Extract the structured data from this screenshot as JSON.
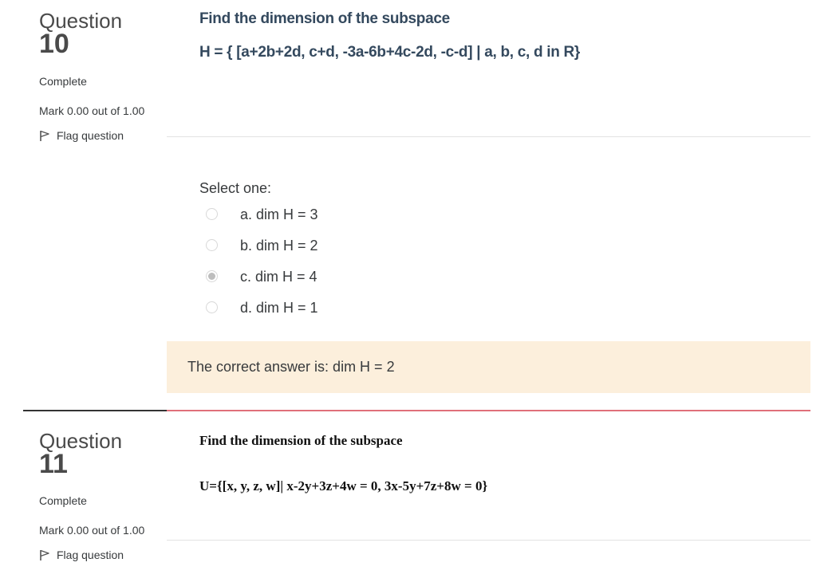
{
  "questions": [
    {
      "word": "Question",
      "number": "10",
      "state": "Complete",
      "grade": "Mark 0.00 out of 1.00",
      "flag": "Flag question",
      "title": "Find the dimension of the subspace",
      "set": "H = { [a+2b+2d, c+d, -3a-6b+4c-2d, -c-d] | a, b, c, d in R}",
      "prompt": "Select one:",
      "options": [
        {
          "label": "a. dim H = 3",
          "checked": false
        },
        {
          "label": "b. dim H = 2",
          "checked": false
        },
        {
          "label": "c. dim H = 4",
          "checked": true
        },
        {
          "label": "d. dim H = 1",
          "checked": false
        }
      ],
      "feedback": "The correct answer is: dim H = 2"
    },
    {
      "word": "Question",
      "number": "11",
      "state": "Complete",
      "grade": "Mark 0.00 out of 1.00",
      "flag": "Flag question",
      "title": "Find the dimension of the subspace",
      "set": "U={[x, y, z, w]| x-2y+3z+4w = 0, 3x-5y+7z+8w = 0}"
    }
  ],
  "colors": {
    "feedback_bg": "#fcefdc",
    "divider_accent": "#e0707a",
    "heading_text": "#34495e"
  }
}
